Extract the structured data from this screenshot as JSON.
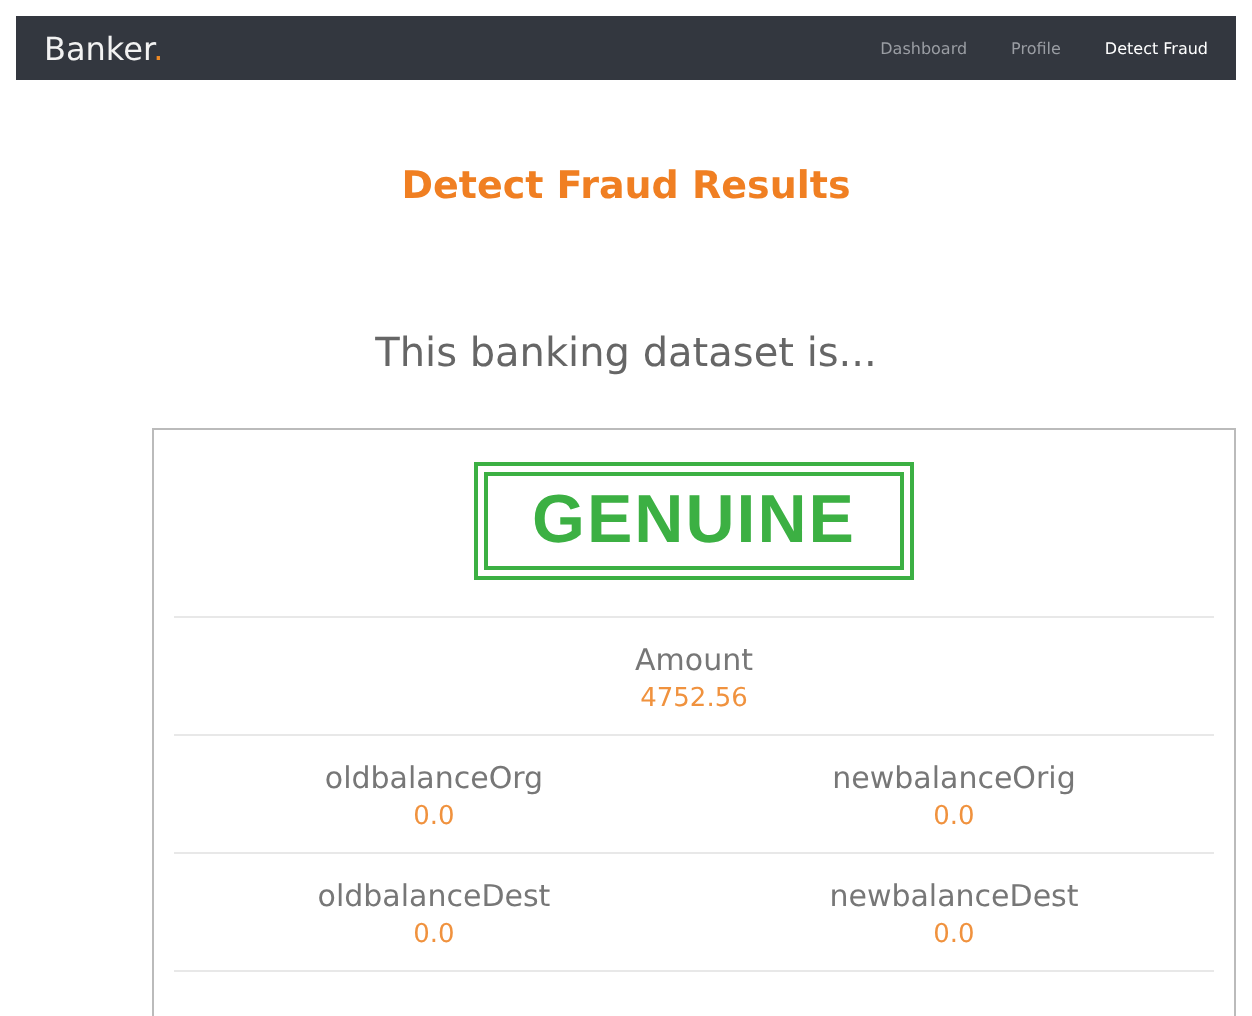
{
  "navbar": {
    "brand": "Banker",
    "brand_dot": ".",
    "links": [
      {
        "label": "Dashboard",
        "selected": false
      },
      {
        "label": "Profile",
        "selected": false
      },
      {
        "label": "Detect Fraud",
        "selected": true
      }
    ]
  },
  "title": "Detect Fraud Results",
  "subtitle": "This banking dataset is...",
  "result": {
    "stamp": "GENUINE",
    "kind": "genuine"
  },
  "fields": [
    [
      {
        "label": "Amount",
        "value": "4752.56"
      }
    ],
    [
      {
        "label": "oldbalanceOrg",
        "value": "0.0"
      },
      {
        "label": "newbalanceOrig",
        "value": "0.0"
      }
    ],
    [
      {
        "label": "oldbalanceDest",
        "value": "0.0"
      },
      {
        "label": "newbalanceDest",
        "value": "0.0"
      }
    ]
  ]
}
